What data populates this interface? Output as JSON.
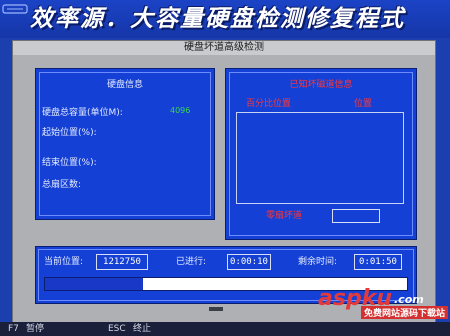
{
  "banner": {
    "title": "效率源．大容量硬盘检测修复程式"
  },
  "window": {
    "title": "硬盘坏道高级检测"
  },
  "disk_info": {
    "heading": "硬盘信息",
    "capacity_label": "硬盘总容量(单位M):",
    "capacity_value": "4096",
    "start_label": "起始位置(%):",
    "end_label": "结束位置(%):",
    "sectors_label": "总扇区数:"
  },
  "bad_sectors": {
    "heading": "已知坏磁道信息",
    "col_percent": "百分比位置",
    "col_position": "位置",
    "repair_label": "零扇坏道",
    "repair_value": ""
  },
  "status": {
    "current_label": "当前位置:",
    "current_value": "1212750",
    "elapsed_label": "已进行:",
    "elapsed_value": "0:00:10",
    "remaining_label": "剩余时间:",
    "remaining_value": "0:01:50",
    "progress_fraction": 0.27
  },
  "footer": {
    "f7_key": "F7",
    "f7_label": "暂停",
    "esc_key": "ESC",
    "esc_label": "终止"
  },
  "watermark": {
    "brand": "aspku",
    "tld": ".com",
    "slogan": "免费网站源码下载站"
  },
  "colors": {
    "background": "#1c3fb0",
    "panel": "#1440d6",
    "window": "#aeb0b3",
    "accent_red": "#ff3636",
    "value_green": "#38d84a"
  }
}
